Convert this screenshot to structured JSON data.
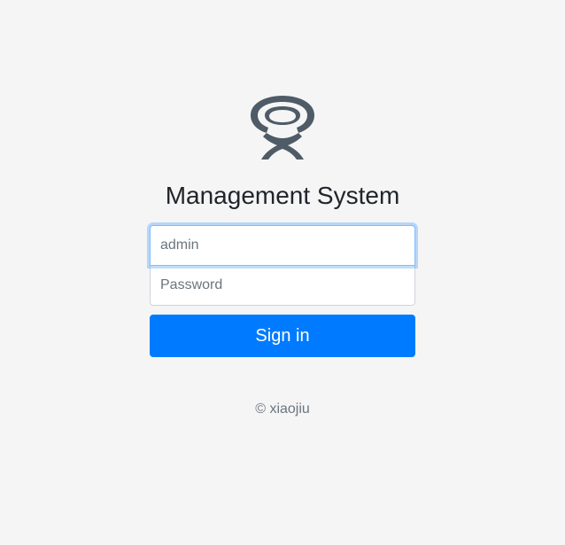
{
  "logo": {
    "icon": "app-logo-icon",
    "color": "#4f5b66"
  },
  "title": "Management System",
  "form": {
    "email_value": "",
    "email_placeholder": "admin",
    "password_value": "",
    "password_placeholder": "Password",
    "submit_label": "Sign in"
  },
  "footer": {
    "copyright": "© xiaojiu"
  },
  "colors": {
    "background": "#f5f5f5",
    "primary": "#007bff",
    "focus_border": "#80bdff"
  }
}
